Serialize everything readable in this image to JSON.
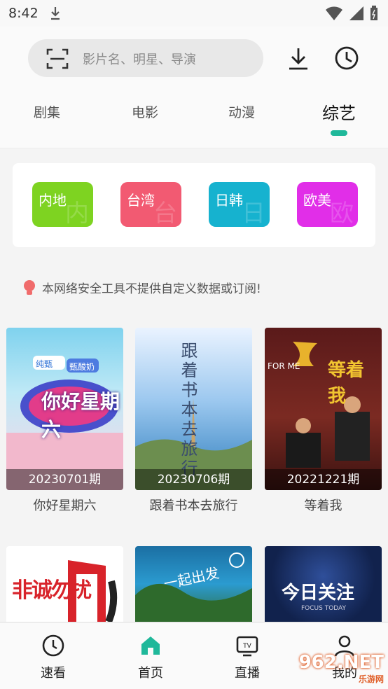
{
  "status": {
    "time": "8:42"
  },
  "search": {
    "placeholder": "影片名、明星、导演"
  },
  "tabs": [
    {
      "label": "剧集",
      "active": false
    },
    {
      "label": "电影",
      "active": false
    },
    {
      "label": "动漫",
      "active": false
    },
    {
      "label": "综艺",
      "active": true
    }
  ],
  "regions": [
    {
      "label": "内地",
      "watermark": "内",
      "color": "#7ed321"
    },
    {
      "label": "台湾",
      "watermark": "台",
      "color": "#f25a72"
    },
    {
      "label": "日韩",
      "watermark": "日",
      "color": "#16b2cf"
    },
    {
      "label": "欧美",
      "watermark": "欧",
      "color": "#e12ee8"
    }
  ],
  "notice": "本网络安全工具不提供自定义数据或订阅!",
  "shows": [
    {
      "title": "你好星期六",
      "episode": "20230701期"
    },
    {
      "title": "跟着书本去旅行",
      "episode": "20230706期"
    },
    {
      "title": "等着我",
      "episode": "20221221期"
    }
  ],
  "posters": {
    "p1_brand": "纯甄",
    "p1_sub": "甄酸奶",
    "p1_art": "你好星期六",
    "p2_art": "跟着书本去旅行",
    "p3_art": "等着我",
    "p3_tag": "FOR ME",
    "p4_art": "非诚勿扰",
    "p5_art": "一起出发",
    "p6_art": "今日关注",
    "p6_sub": "FOCUS TODAY"
  },
  "bottom_nav": [
    {
      "label": "速看",
      "icon": "clock-outline-icon",
      "active": false
    },
    {
      "label": "首页",
      "icon": "home-icon",
      "active": true
    },
    {
      "label": "直播",
      "icon": "tv-icon",
      "active": false
    },
    {
      "label": "我的",
      "icon": "user-icon",
      "active": false
    }
  ],
  "watermark": {
    "brand": "962.NET",
    "sub": "乐游网"
  },
  "colors": {
    "accent": "#1fb89a",
    "notice_icon": "#f06b6b"
  }
}
